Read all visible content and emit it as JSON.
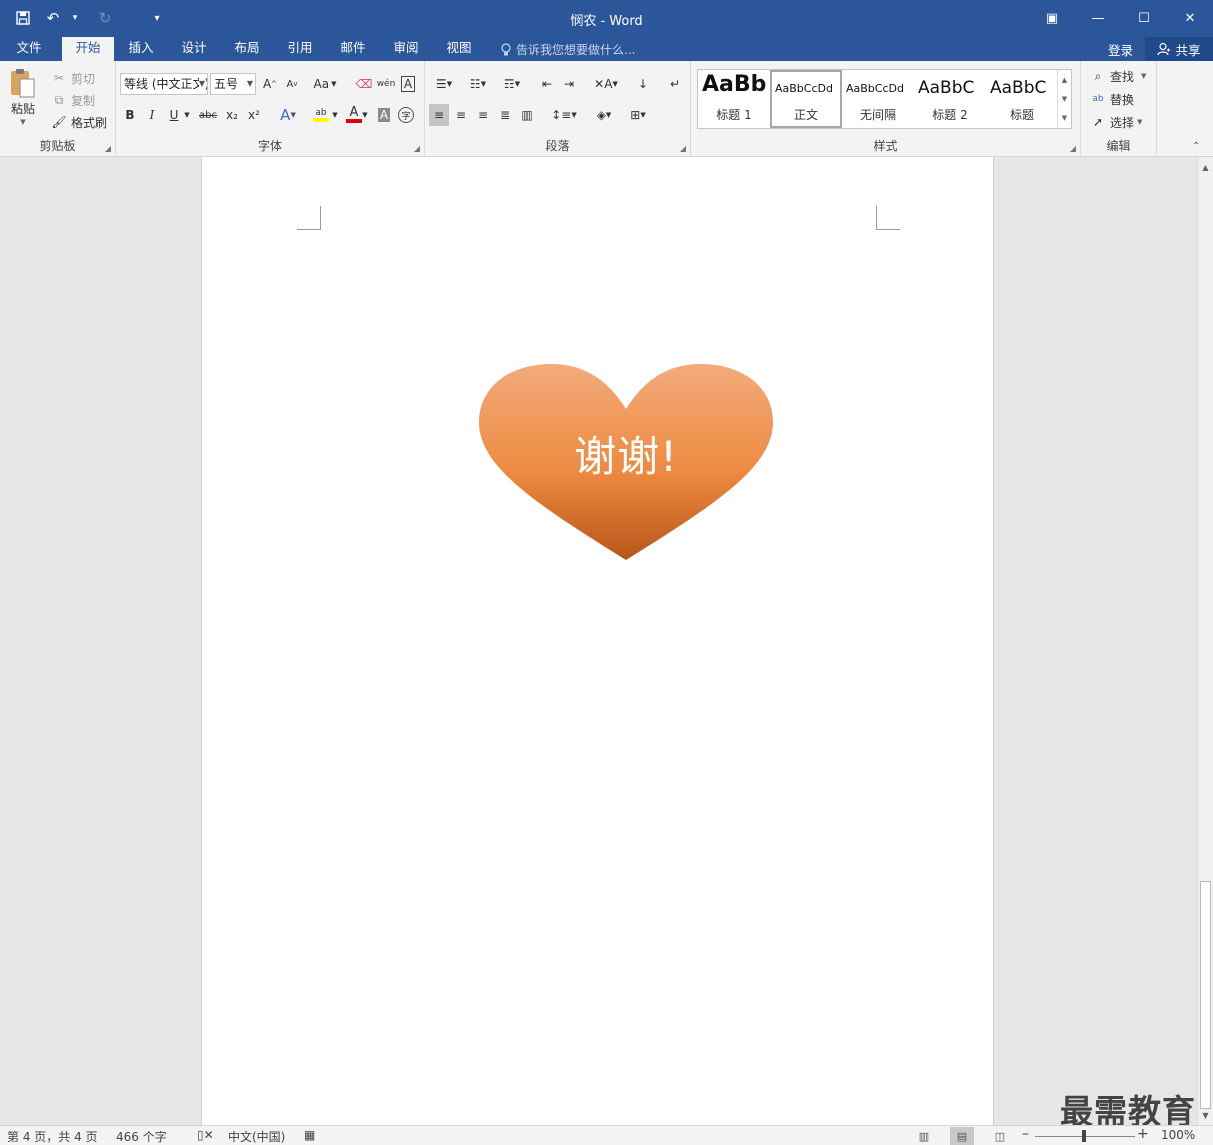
{
  "app": {
    "document_title": "悯农 - Word",
    "window_controls": {
      "ribbon_display": "▣",
      "minimize": "—",
      "maximize": "☐",
      "close": "✕"
    }
  },
  "qat": {
    "save": "💾",
    "undo": "↶",
    "undo_menu": "▾",
    "redo": "↻",
    "customize": "▾"
  },
  "tabs": [
    "文件",
    "开始",
    "插入",
    "设计",
    "布局",
    "引用",
    "邮件",
    "审阅",
    "视图"
  ],
  "active_tab": "开始",
  "tell_me": "告诉我您想要做什么...",
  "account": {
    "login": "登录",
    "share": "共享"
  },
  "clipboard": {
    "label": "剪贴板",
    "paste": "粘贴",
    "cut": "剪切",
    "copy": "复制",
    "format_painter": "格式刷"
  },
  "font": {
    "label": "字体",
    "font_name": "等线 (中文正文)",
    "font_size": "五号",
    "grow": "A",
    "shrink": "A",
    "change_case": "Aa",
    "bold": "B",
    "italic": "I",
    "underline": "U",
    "strike": "abc",
    "subscript": "x₂",
    "superscript": "x²",
    "font_color_letter": "A",
    "highlight_letter": "ab",
    "phonetic": "wén",
    "char_border": "A",
    "char_shading": "A",
    "enclose": "字"
  },
  "paragraph": {
    "label": "段落"
  },
  "styles": {
    "label": "样式",
    "items": [
      {
        "sample": "AaBb",
        "name": "标题 1"
      },
      {
        "sample": "AaBbCcDd",
        "name": "正文"
      },
      {
        "sample": "AaBbCcDd",
        "name": "无间隔"
      },
      {
        "sample": "AaBbC",
        "name": "标题 2"
      },
      {
        "sample": "AaBbC",
        "name": "标题"
      }
    ]
  },
  "editing": {
    "label": "编辑",
    "find": "查找",
    "replace": "替换",
    "select": "选择"
  },
  "document": {
    "heart_text": "谢谢!",
    "heart_colors": {
      "top": "#f2ab7c",
      "mid": "#ee8a40",
      "bottom": "#b8561a"
    }
  },
  "status": {
    "page": "第 4 页，共 4 页",
    "words": "466 个字",
    "language": "中文(中国)",
    "zoom": "100%"
  },
  "watermark": "最需教育"
}
